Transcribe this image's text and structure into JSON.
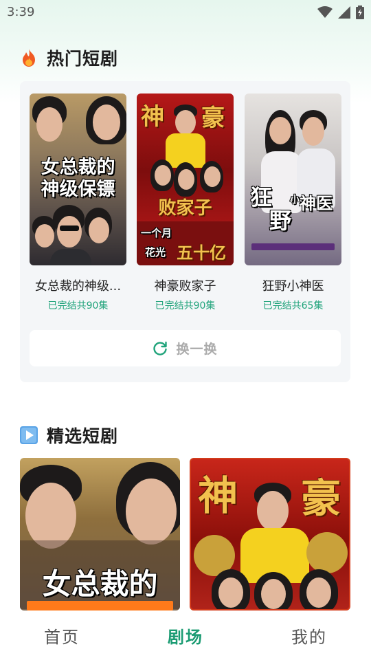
{
  "status_bar": {
    "time": "3:39",
    "icons": [
      "wifi-icon",
      "signal-icon",
      "battery-charging-icon"
    ]
  },
  "hot_section": {
    "title": "热门短剧",
    "icon": "fire-icon",
    "items": [
      {
        "name": "女总裁的神级...",
        "status": "已完结共90集",
        "poster_text": [
          "女总裁的",
          "神级保镖"
        ]
      },
      {
        "name": "神豪败家子",
        "status": "已完结共90集",
        "poster_text": [
          "神",
          "豪",
          "败家子",
          "一个月",
          "花光",
          "五十亿"
        ]
      },
      {
        "name": "狂野小神医",
        "status": "已完结共65集",
        "poster_text": [
          "狂",
          "野",
          "小",
          "神医"
        ]
      }
    ],
    "refresh_label": "换一换"
  },
  "featured_section": {
    "title": "精选短剧",
    "icon": "play-icon",
    "items": [
      {
        "poster_text": [
          "女总裁的"
        ]
      },
      {
        "poster_text": [
          "神",
          "豪"
        ]
      }
    ]
  },
  "bottom_nav": {
    "items": [
      {
        "label": "首页",
        "active": false
      },
      {
        "label": "剧场",
        "active": true
      },
      {
        "label": "我的",
        "active": false
      }
    ]
  },
  "colors": {
    "accent": "#1a9b72",
    "status_green": "#1fa37a"
  }
}
